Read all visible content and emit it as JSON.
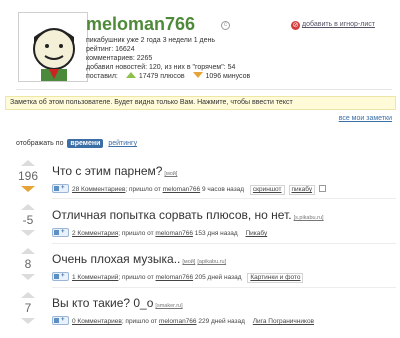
{
  "profile": {
    "username": "meloman766",
    "ignore_label": "добавить в игнор-лист",
    "stats": [
      "пикабушник уже 2 года 3 недели 1 день",
      "рейтинг: 16624",
      "комментариев: 2265",
      "добавил новостей: 120, из них в \"горячем\": 54"
    ],
    "gave_label": "поставил:",
    "pluses": "17479 плюсов",
    "minuses": "1096 минусов"
  },
  "note": {
    "text": "Заметка об этом пользователе. Будет видна только Вам. Нажмите, чтобы ввести текст",
    "all_notes_link": "все мои заметки"
  },
  "sort": {
    "label": "отображать по",
    "active": "времени",
    "inactive": "рейтингу"
  },
  "posts": [
    {
      "score": "196",
      "title": "Что с этим парнем?",
      "domain": "[мой]",
      "comments": "28 Комментариев",
      "posted": "; пришло от",
      "author": "meloman766",
      "age": "9 часов назад",
      "tags": [
        "скриншот",
        "пикабу"
      ],
      "down_active": true
    },
    {
      "score": "-5",
      "title": "Отличная попытка сорвать плюсов, но нет.",
      "domain": "[s.pikabu.ru]",
      "comments": "2 Комментария",
      "posted": "; пришло от",
      "author": "meloman766",
      "age": "153 дня назад",
      "tags": [
        "Пикабу"
      ],
      "down_active": false
    },
    {
      "score": "8",
      "title": "Очень плохая музыка..",
      "domain": "[мой]",
      "domain2": "[apikabu.ru]",
      "comments": "1 Комментарий",
      "posted": "; пришло от",
      "author": "meloman766",
      "age": "205 дней назад",
      "tags": [
        "Картинки и фото"
      ],
      "down_active": false
    },
    {
      "score": "7",
      "title": "Вы кто такие? 0_о",
      "domain": "[smaker.ru]",
      "comments": "0 Комментариев",
      "posted": "; пришло от",
      "author": "meloman766",
      "age": "229 дней назад",
      "tags": [
        "Лига Пограничников"
      ],
      "down_active": false
    }
  ],
  "colors": {
    "username": "#4f8a3a",
    "sort_active_bg": "#3a6ea5",
    "note_bg": "#fffbd9",
    "plus_triangle": "#8cc04b",
    "minus_triangle": "#e6a33a"
  }
}
